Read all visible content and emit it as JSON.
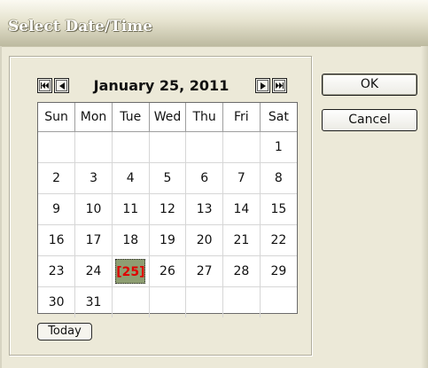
{
  "dialog": {
    "title": "Select Date/Time"
  },
  "calendar": {
    "month_label": "January 25, 2011",
    "weekdays": [
      "Sun",
      "Mon",
      "Tue",
      "Wed",
      "Thu",
      "Fri",
      "Sat"
    ],
    "weeks": [
      [
        {
          "d": ""
        },
        {
          "d": ""
        },
        {
          "d": ""
        },
        {
          "d": ""
        },
        {
          "d": ""
        },
        {
          "d": ""
        },
        {
          "d": "1"
        }
      ],
      [
        {
          "d": "2"
        },
        {
          "d": "3"
        },
        {
          "d": "4"
        },
        {
          "d": "5"
        },
        {
          "d": "6"
        },
        {
          "d": "7"
        },
        {
          "d": "8"
        }
      ],
      [
        {
          "d": "9"
        },
        {
          "d": "10"
        },
        {
          "d": "11"
        },
        {
          "d": "12"
        },
        {
          "d": "13"
        },
        {
          "d": "14"
        },
        {
          "d": "15"
        }
      ],
      [
        {
          "d": "16"
        },
        {
          "d": "17"
        },
        {
          "d": "18"
        },
        {
          "d": "19"
        },
        {
          "d": "20"
        },
        {
          "d": "21"
        },
        {
          "d": "22"
        }
      ],
      [
        {
          "d": "23"
        },
        {
          "d": "24"
        },
        {
          "d": "[25]",
          "selected": true
        },
        {
          "d": "26",
          "other": true
        },
        {
          "d": "27",
          "other": true
        },
        {
          "d": "28",
          "other": true
        },
        {
          "d": "29",
          "other": true
        }
      ],
      [
        {
          "d": "30",
          "other": true
        },
        {
          "d": "31",
          "other": true
        },
        {
          "d": ""
        },
        {
          "d": ""
        },
        {
          "d": ""
        },
        {
          "d": ""
        },
        {
          "d": ""
        }
      ]
    ]
  },
  "buttons": {
    "today": "Today",
    "ok": "OK",
    "cancel": "Cancel"
  },
  "icons": {
    "prev_year": "double-left-arrow-icon",
    "prev_month": "left-arrow-icon",
    "next_month": "right-arrow-icon",
    "next_year": "double-right-arrow-icon"
  },
  "colors": {
    "selected_text": "#e00000",
    "selected_bg": "#8e9e72",
    "window_bg": "#ece9d8"
  }
}
